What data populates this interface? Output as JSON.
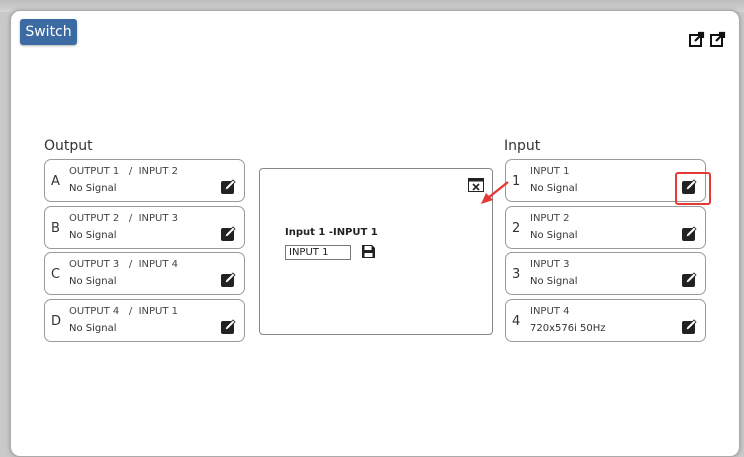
{
  "tab_label": "Switch",
  "output_title": "Output",
  "input_title": "Input",
  "outputs": [
    {
      "letter": "A",
      "name": "OUTPUT 1",
      "sep": "/",
      "source": "INPUT 2",
      "status": "No Signal"
    },
    {
      "letter": "B",
      "name": "OUTPUT 2",
      "sep": "/",
      "source": "INPUT 3",
      "status": "No Signal"
    },
    {
      "letter": "C",
      "name": "OUTPUT 3",
      "sep": "/",
      "source": "INPUT 4",
      "status": "No Signal"
    },
    {
      "letter": "D",
      "name": "OUTPUT 4",
      "sep": "/",
      "source": "INPUT 1",
      "status": "No Signal"
    }
  ],
  "inputs": [
    {
      "num": "1",
      "name": "INPUT 1",
      "status": "No Signal"
    },
    {
      "num": "2",
      "name": "INPUT 2",
      "status": "No Signal"
    },
    {
      "num": "3",
      "name": "INPUT 3",
      "status": "No Signal"
    },
    {
      "num": "4",
      "name": "INPUT 4",
      "status": "720x576i 50Hz"
    }
  ],
  "editor": {
    "label": "Input 1 -INPUT 1",
    "value": "INPUT 1"
  },
  "colors": {
    "tab": "#3c6aa3",
    "highlight": "#e53935"
  }
}
